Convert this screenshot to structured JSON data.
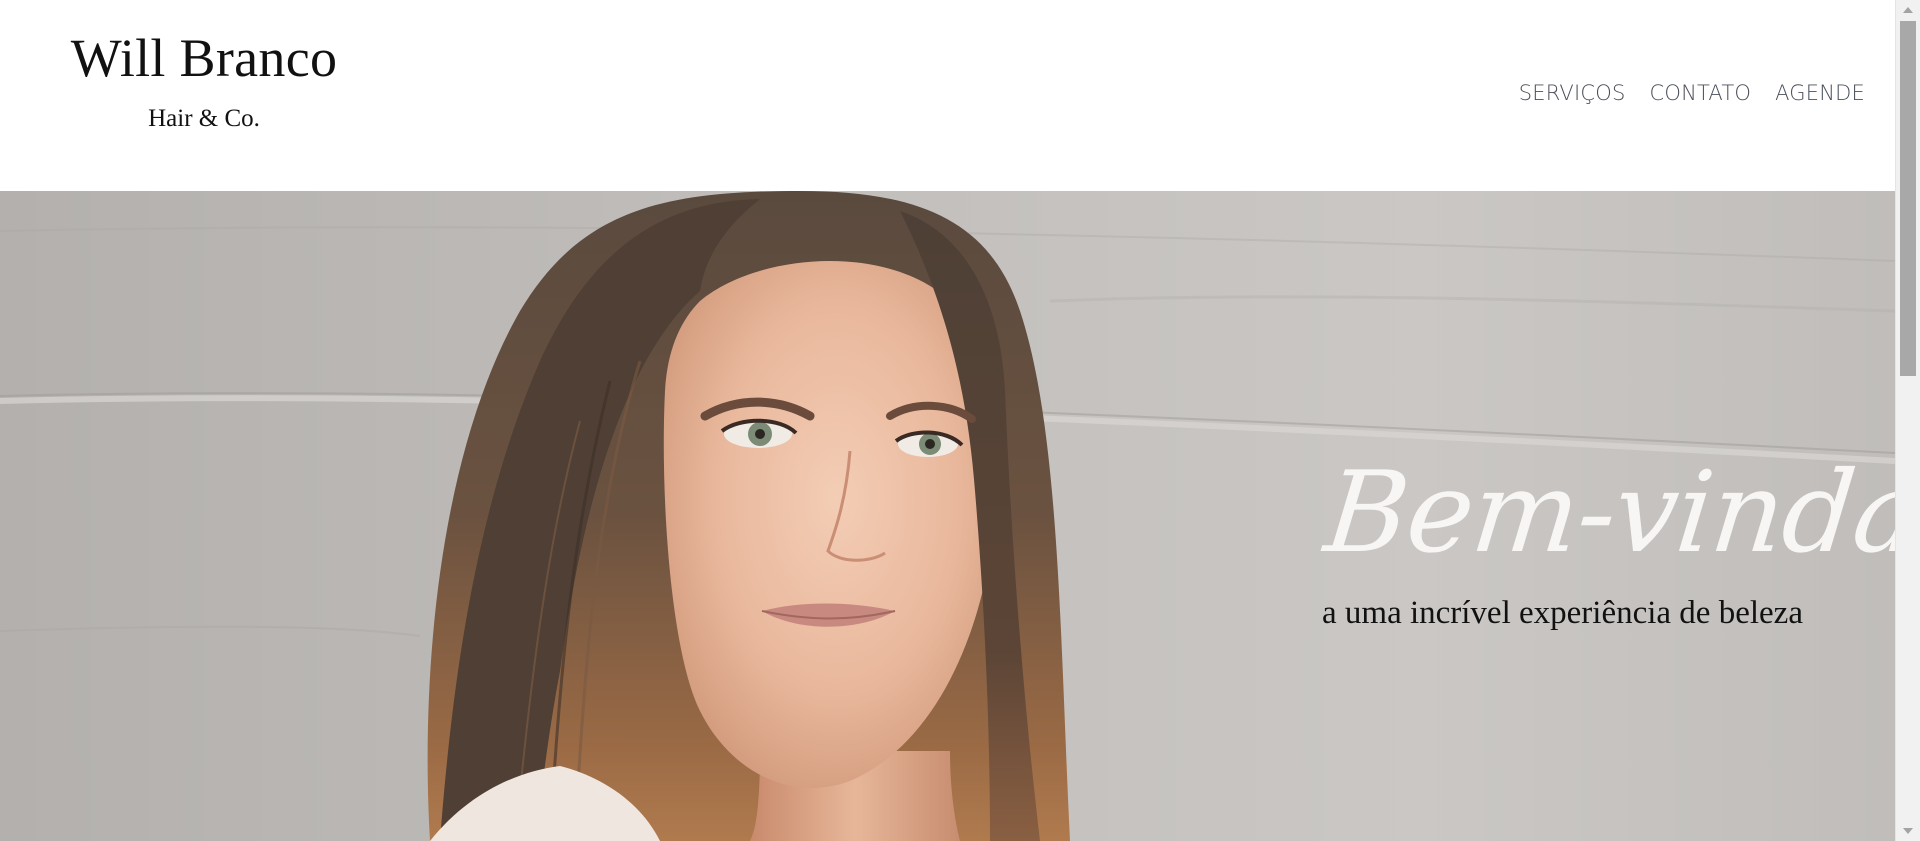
{
  "header": {
    "brand_name": "Will Branco",
    "brand_tagline": "Hair & Co.",
    "nav": [
      {
        "label": "SERVIÇOS"
      },
      {
        "label": "CONTATO"
      },
      {
        "label": "AGENDE"
      }
    ]
  },
  "hero": {
    "title": "Bem-vinda",
    "subtitle": "a uma incrível experiência de beleza",
    "photo_icon": "portrait-photo"
  },
  "colors": {
    "nav_text": "#4a4f5a",
    "brand_text": "#111111",
    "hero_title": "#f7f6f4",
    "hero_background": "#c2bfbc"
  }
}
